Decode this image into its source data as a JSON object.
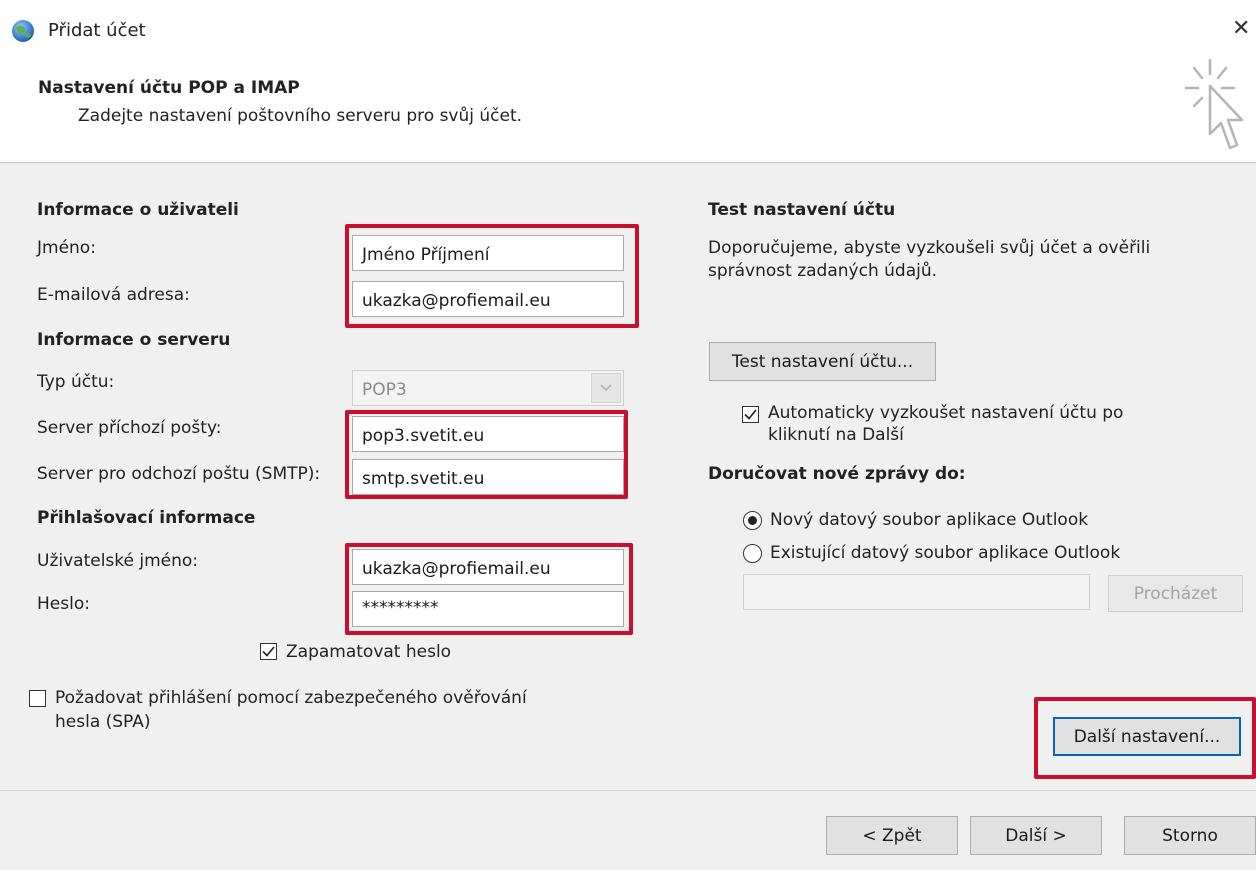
{
  "window": {
    "title": "Přidat účet",
    "close_glyph": "✕"
  },
  "header": {
    "title": "Nastavení účtu POP a IMAP",
    "subtitle": "Zadejte nastavení poštovního serveru pro svůj účet."
  },
  "user_info": {
    "heading": "Informace o uživateli",
    "name_label": "Jméno:",
    "name_value": "Jméno Příjmení",
    "email_label": "E-mailová adresa:",
    "email_value": "ukazka@profiemail.eu"
  },
  "server_info": {
    "heading": "Informace o serveru",
    "type_label": "Typ účtu:",
    "type_value": "POP3",
    "incoming_label": "Server příchozí pošty:",
    "incoming_value": "pop3.svetit.eu",
    "outgoing_label": "Server pro odchozí poštu (SMTP):",
    "outgoing_value": "smtp.svetit.eu"
  },
  "login_info": {
    "heading": "Přihlašovací informace",
    "username_label": "Uživatelské jméno:",
    "username_value": "ukazka@profiemail.eu",
    "password_label": "Heslo:",
    "password_value": "*********",
    "remember_label": "Zapamatovat heslo",
    "remember_checked": true,
    "spa_label_line1": "Požadovat přihlášení pomocí zabezpečeného ověřování",
    "spa_label_line2": "hesla (SPA)",
    "spa_checked": false
  },
  "test": {
    "heading": "Test nastavení účtu",
    "description_line1": "Doporučujeme, abyste vyzkoušeli svůj účet a ověřili",
    "description_line2": "správnost zadaných údajů.",
    "button_label": "Test nastavení účtu...",
    "auto_test_line1": "Automaticky vyzkoušet nastavení účtu po",
    "auto_test_line2": "kliknutí na Další",
    "auto_test_checked": true
  },
  "delivery": {
    "heading": "Doručovat nové zprávy do:",
    "option_new": "Nový datový soubor aplikace Outlook",
    "option_existing": "Existující datový soubor aplikace Outlook",
    "selected": "new",
    "browse_label": "Procházet",
    "file_path": ""
  },
  "more_settings_label": "Další nastavení...",
  "footer": {
    "back_label": "< Zpět",
    "next_label": "Další >",
    "cancel_label": "Storno"
  },
  "colors": {
    "highlight": "#c8102e",
    "focus": "#0a64b4",
    "background": "#f0f0f0"
  }
}
